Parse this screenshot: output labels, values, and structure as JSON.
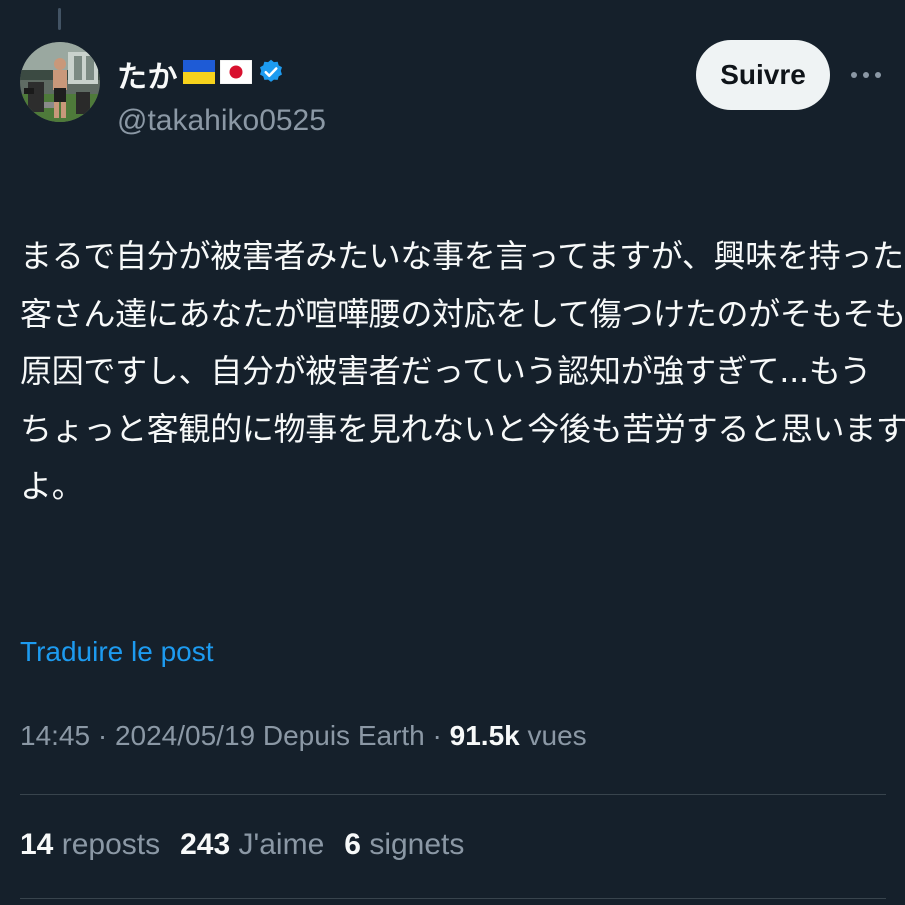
{
  "user": {
    "display_name": "たか",
    "handle": "@takahiko0525",
    "badges": [
      "ukraine-flag-icon",
      "japan-flag-icon",
      "verified-badge-icon"
    ],
    "verified_color": "#1d9bf0"
  },
  "actions": {
    "follow_label": "Suivre",
    "more_icon": "more-horizontal-icon"
  },
  "tweet": {
    "lines": [
      "まるで自分が被害者みたいな事を言ってますが、興味を持ったお",
      "客さん達にあなたが喧嘩腰の対応をして傷つけたのがそもそもの",
      "原因ですし、自分が被害者だっていう認知が強すぎて...もう",
      "ちょっと客観的に物事を見れないと今後も苦労すると思います",
      "よ。"
    ],
    "translate_label": "Traduire le post"
  },
  "meta": {
    "time": "14:45",
    "separator": " · ",
    "date": "2024/05/19",
    "source": "Depuis Earth",
    "views_count": "91.5k",
    "views_label": "vues"
  },
  "stats": {
    "reposts_count": "14",
    "reposts_label": "reposts",
    "likes_count": "243",
    "likes_label": "J'aime",
    "bookmarks_count": "6",
    "bookmarks_label": "signets"
  },
  "colors": {
    "background": "#15202b",
    "primary_text": "#f7f9f9",
    "secondary_text": "#8b98a5",
    "link": "#1d9bf0",
    "divider": "#38444d"
  }
}
